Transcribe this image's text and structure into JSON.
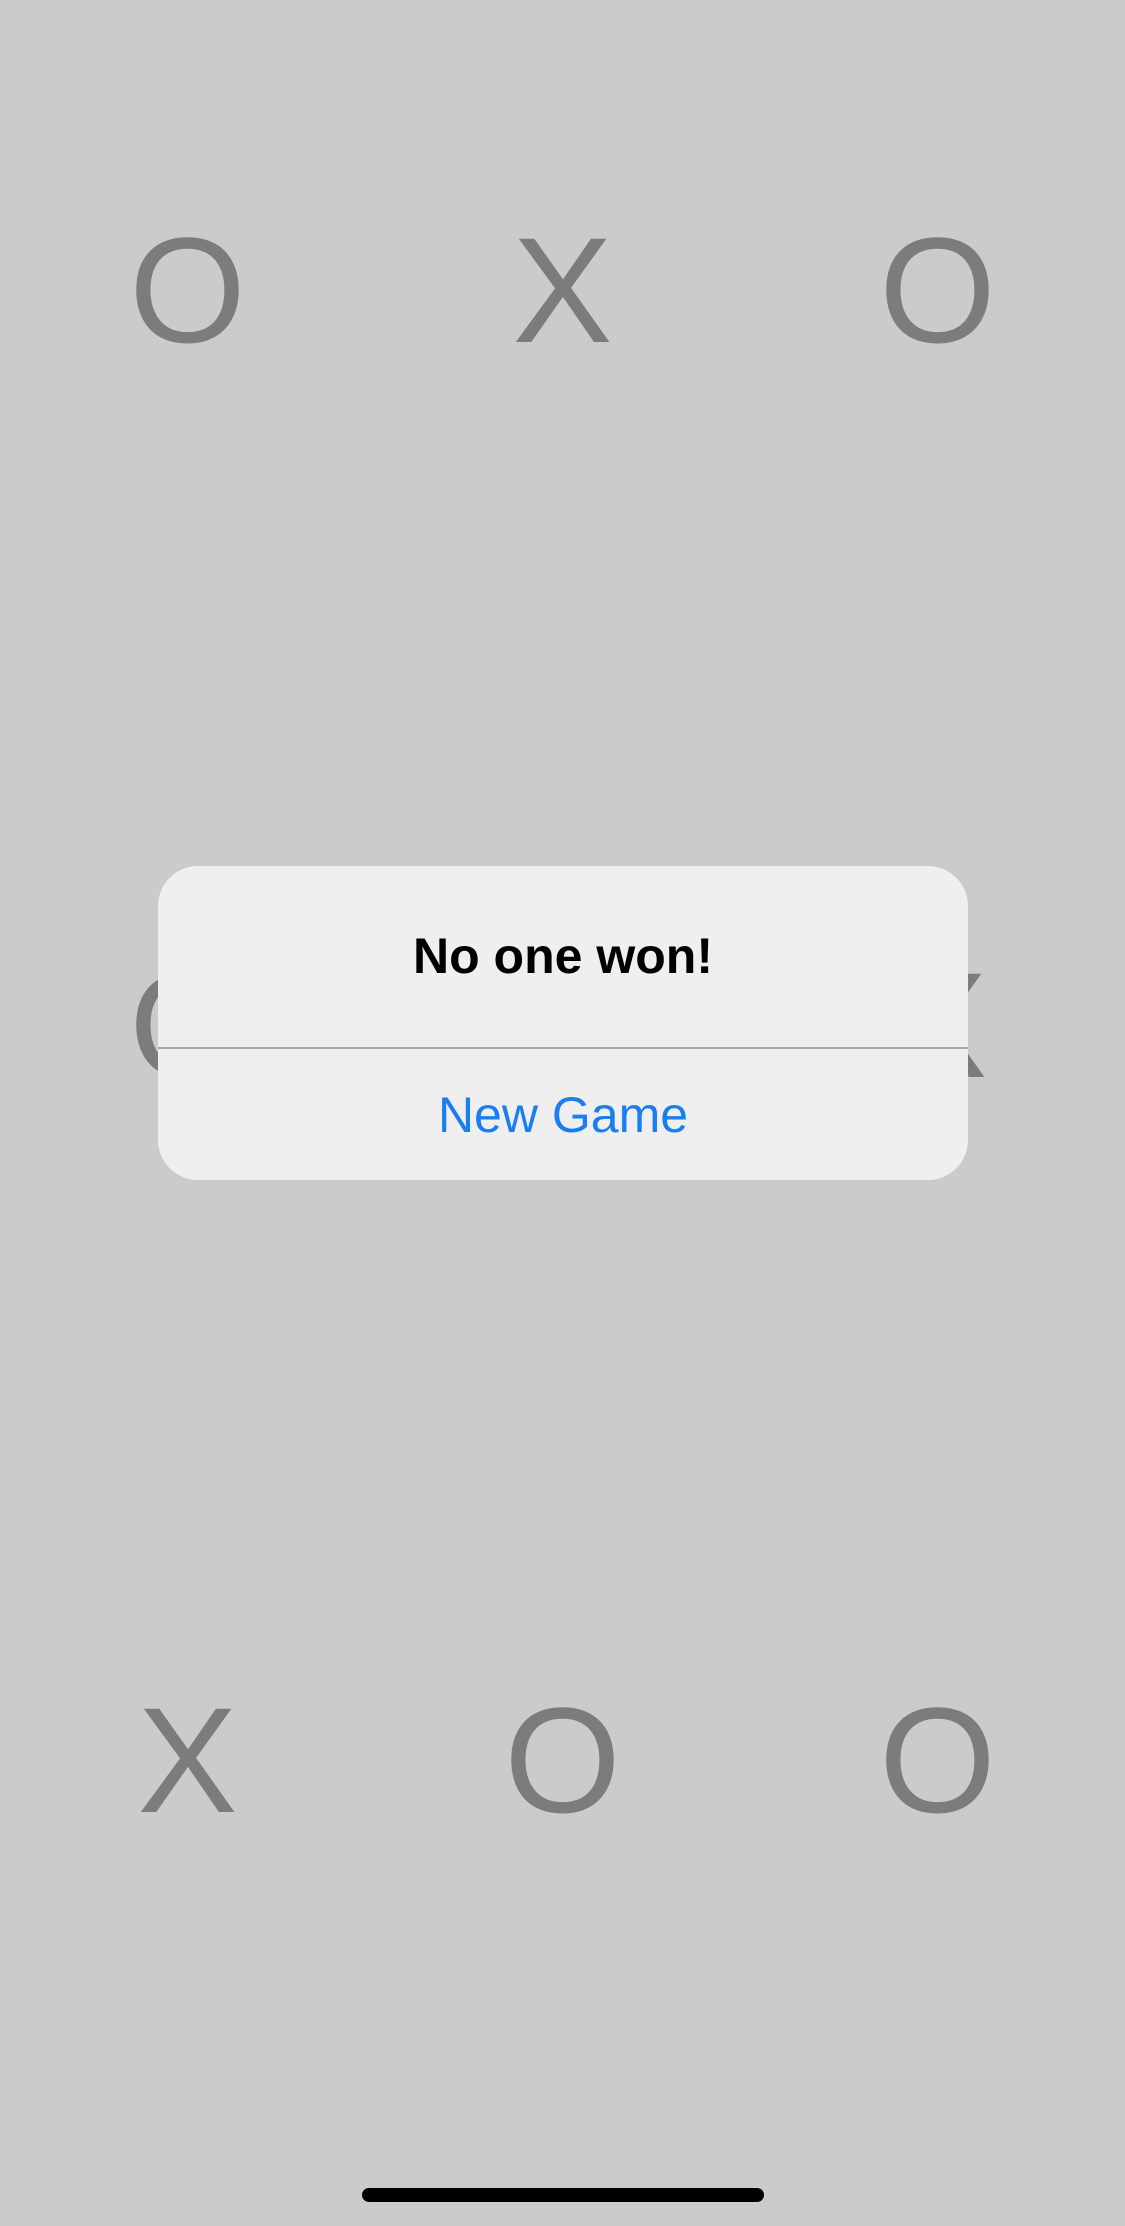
{
  "board": {
    "rows": [
      [
        "O",
        "X",
        "O"
      ],
      [
        "O",
        "",
        "X"
      ],
      [
        "X",
        "O",
        "O"
      ]
    ]
  },
  "alert": {
    "title": "No one won!",
    "button_label": "New Game"
  },
  "colors": {
    "background": "#cbcbcb",
    "mark": "#7c7c7c",
    "alert_background": "#efefef",
    "button_text": "#1a7ef0"
  }
}
